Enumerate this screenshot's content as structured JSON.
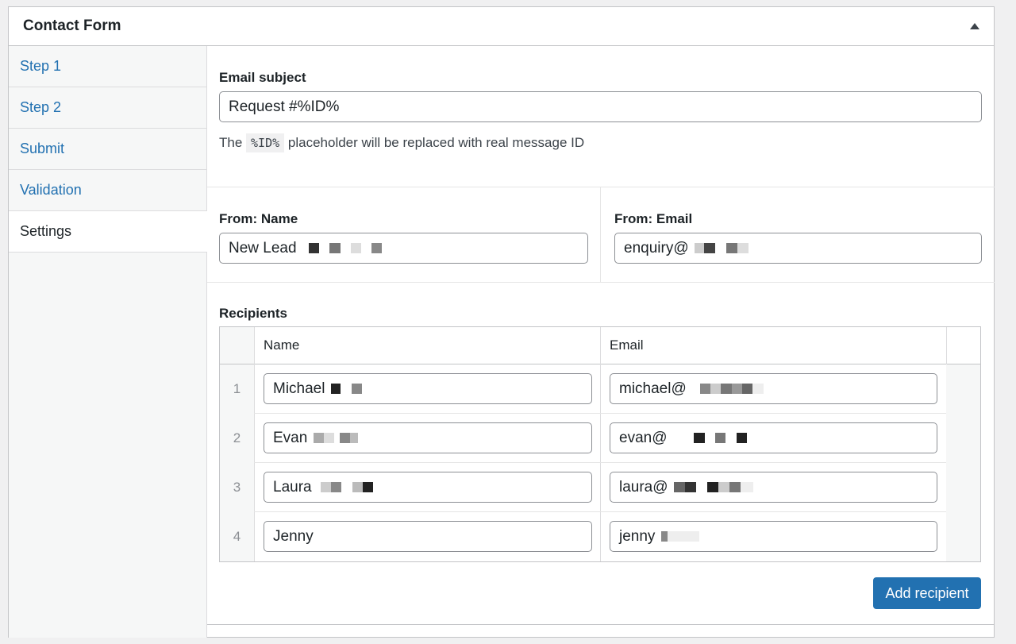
{
  "panel": {
    "title": "Contact Form",
    "toggle_icon": "triangle-up-icon"
  },
  "sidebar": {
    "items": [
      {
        "label": "Step 1",
        "active": false
      },
      {
        "label": "Step 2",
        "active": false
      },
      {
        "label": "Submit",
        "active": false
      },
      {
        "label": "Validation",
        "active": false
      },
      {
        "label": "Settings",
        "active": true
      }
    ]
  },
  "email_subject": {
    "label": "Email subject",
    "value": "Request #%ID%",
    "help_prefix": "The",
    "help_code": "%ID%",
    "help_suffix": "placeholder will be replaced with real message ID"
  },
  "from_name": {
    "label": "From: Name",
    "value": "New Lead"
  },
  "from_email": {
    "label": "From: Email",
    "value": "enquiry@"
  },
  "recipients": {
    "label": "Recipients",
    "columns": [
      "Name",
      "Email"
    ],
    "rows": [
      {
        "num": "1",
        "name": "Michael",
        "email": "michael@"
      },
      {
        "num": "2",
        "name": "Evan",
        "email": "evan@"
      },
      {
        "num": "3",
        "name": "Laura",
        "email": "laura@"
      },
      {
        "num": "4",
        "name": "Jenny",
        "email": "jenny"
      }
    ],
    "add_button": "Add recipient"
  },
  "colors": {
    "accent": "#2271b1",
    "link": "#2271b1",
    "border": "#c3c4c7"
  }
}
